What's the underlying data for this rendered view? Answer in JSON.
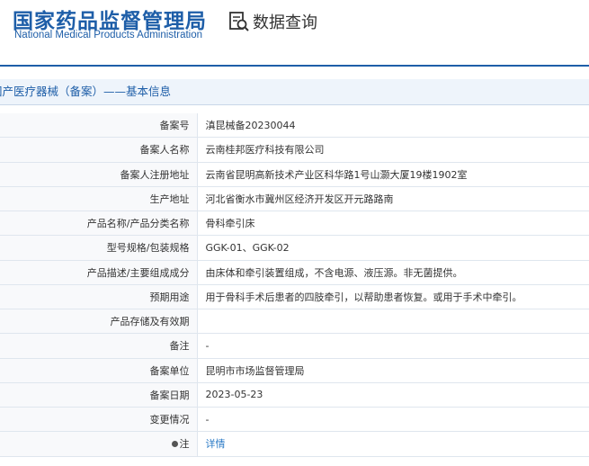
{
  "header": {
    "logo_cn": "国家药品监督管理局",
    "logo_en": "National Medical Products Administration",
    "query_label": "数据查询",
    "query_icon": "search-document-icon"
  },
  "section": {
    "title": "国产医疗器械（备案）——基本信息"
  },
  "rows": [
    {
      "label": "备案号",
      "value": "滇昆械备20230044"
    },
    {
      "label": "备案人名称",
      "value": "云南桂邦医疗科技有限公司"
    },
    {
      "label": "备案人注册地址",
      "value": "云南省昆明高新技术产业区科华路1号山灏大厦19楼1902室"
    },
    {
      "label": "生产地址",
      "value": "河北省衡水市冀州区经济开发区开元路路南"
    },
    {
      "label": "产品名称/产品分类名称",
      "value": "骨科牵引床"
    },
    {
      "label": "型号规格/包装规格",
      "value": "GGK-01、GGK-02"
    },
    {
      "label": "产品描述/主要组成成分",
      "value": "由床体和牵引装置组成，不含电源、液压源。非无菌提供。"
    },
    {
      "label": "预期用途",
      "value": "用于骨科手术后患者的四肢牵引，以帮助患者恢复。或用于手术中牵引。"
    },
    {
      "label": "产品存储及有效期",
      "value": ""
    },
    {
      "label": "备注",
      "value": "-"
    },
    {
      "label": "备案单位",
      "value": "昆明市市场监督管理局"
    },
    {
      "label": "备案日期",
      "value": "2023-05-23"
    },
    {
      "label": "变更情况",
      "value": "-"
    },
    {
      "label": "注",
      "value": "详情",
      "icon": "bulb-icon"
    }
  ],
  "colors": {
    "brand": "#1e5ea8",
    "link": "#2a7ac6"
  }
}
